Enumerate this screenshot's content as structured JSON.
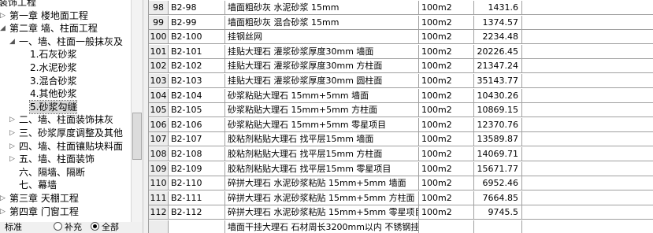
{
  "tree": {
    "items": [
      {
        "label": "装饰工程",
        "twisty": ""
      },
      {
        "label": "第一章 楼地面工程",
        "twisty": "▷"
      },
      {
        "label": "第二章 墙、柱面工程",
        "twisty": "◢"
      },
      {
        "label": "一、墙、柱面一般抹灰及",
        "twisty": "◢"
      },
      {
        "label": "1.石灰砂浆",
        "twisty": ""
      },
      {
        "label": "2.水泥砂浆",
        "twisty": ""
      },
      {
        "label": "3.混合砂浆",
        "twisty": ""
      },
      {
        "label": "4.其他砂浆",
        "twisty": ""
      },
      {
        "label": "5.砂浆勾缝",
        "twisty": ""
      },
      {
        "label": "二、墙、柱面装饰抹灰",
        "twisty": "▷"
      },
      {
        "label": "三、砂浆厚度调整及其他",
        "twisty": "▷"
      },
      {
        "label": "四、墙、柱面镶贴块料面",
        "twisty": "▷"
      },
      {
        "label": "五、墙、柱面装饰",
        "twisty": "▷"
      },
      {
        "label": "六、隔墙、隔断",
        "twisty": ""
      },
      {
        "label": "七、幕墙",
        "twisty": ""
      },
      {
        "label": "第三章 天棚工程",
        "twisty": "▷"
      },
      {
        "label": "第四章 门窗工程",
        "twisty": "▷"
      }
    ]
  },
  "filter": {
    "label": "标准",
    "options": [
      {
        "label": "补充",
        "selected": false
      },
      {
        "label": "全部",
        "selected": true
      }
    ]
  },
  "table": {
    "rows": [
      {
        "idx": "98",
        "code": "B2-98",
        "name": "墙面粗砂灰 水泥砂浆 15mm",
        "unit": "100m2",
        "price": "1431.6"
      },
      {
        "idx": "99",
        "code": "B2-99",
        "name": "墙面粗砂灰 混合砂浆 15mm",
        "unit": "100m2",
        "price": "1374.57"
      },
      {
        "idx": "100",
        "code": "B2-100",
        "name": "挂钢丝网",
        "unit": "100m2",
        "price": "2234.48"
      },
      {
        "idx": "101",
        "code": "B2-101",
        "name": "挂贴大理石 灌浆砂浆厚度30mm 墙面",
        "unit": "100m2",
        "price": "20226.45"
      },
      {
        "idx": "102",
        "code": "B2-102",
        "name": "挂贴大理石 灌浆砂浆厚度30mm 方柱面",
        "unit": "100m2",
        "price": "21347.24"
      },
      {
        "idx": "103",
        "code": "B2-103",
        "name": "挂贴大理石 灌浆砂浆厚度30mm 圆柱面",
        "unit": "100m2",
        "price": "35143.77"
      },
      {
        "idx": "104",
        "code": "B2-104",
        "name": "砂浆粘贴大理石 15mm+5mm 墙面",
        "unit": "100m2",
        "price": "10430.26"
      },
      {
        "idx": "105",
        "code": "B2-105",
        "name": "砂浆粘贴大理石 15mm+5mm 方柱面",
        "unit": "100m2",
        "price": "10869.15"
      },
      {
        "idx": "106",
        "code": "B2-106",
        "name": "砂浆粘贴大理石 15mm+5mm 零星项目",
        "unit": "100m2",
        "price": "12370.76"
      },
      {
        "idx": "107",
        "code": "B2-107",
        "name": "胶粘剂粘贴大理石 找平层15mm 墙面",
        "unit": "100m2",
        "price": "13589.87"
      },
      {
        "idx": "108",
        "code": "B2-108",
        "name": "胶粘剂粘贴大理石 找平层15mm 方柱面",
        "unit": "100m2",
        "price": "14069.71"
      },
      {
        "idx": "109",
        "code": "B2-109",
        "name": "胶粘剂粘贴大理石 找平层15mm 零星项目",
        "unit": "100m2",
        "price": "15671.77"
      },
      {
        "idx": "110",
        "code": "B2-110",
        "name": "碎拼大理石 水泥砂浆粘贴 15mm+5mm 墙面",
        "unit": "100m2",
        "price": "6952.46"
      },
      {
        "idx": "111",
        "code": "B2-111",
        "name": "碎拼大理石 水泥砂浆粘贴 15mm+5mm 方柱面",
        "unit": "100m2",
        "price": "7664.85"
      },
      {
        "idx": "112",
        "code": "B2-112",
        "name": "碎拼大理石 水泥砂浆粘贴 15mm+5mm 零星项目",
        "unit": "100m2",
        "price": "9745.5"
      },
      {
        "idx": "",
        "code": "",
        "name": "墙面干挂大理石 石材周长3200mm以内 不锈钢挂",
        "unit": "",
        "price": ""
      }
    ]
  }
}
